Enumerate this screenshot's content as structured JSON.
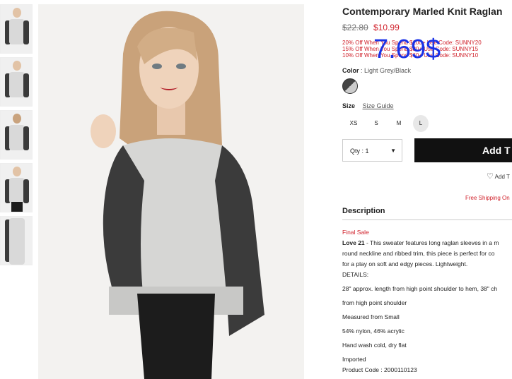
{
  "product": {
    "title": "Contemporary Marled Knit Raglan",
    "old_price": "$22.80",
    "new_price": "$10.99",
    "promos": [
      "20% Off When You Spend $100+ Use Code: SUNNY20",
      "15% Off When You Spend $80+ Use Code: SUNNY15",
      "10% Off When You Spend $60+ Use Code: SUNNY10"
    ],
    "overlay_price": "7.69$",
    "color_label": "Color",
    "color_value": ": Light Grey/Black",
    "size_label": "Size",
    "size_guide": "Size Guide",
    "sizes": [
      "XS",
      "S",
      "M",
      "L"
    ],
    "qty_label": "Qty : 1",
    "add_label": "Add T",
    "wishlist": "Add T",
    "shipping": "Free Shipping On",
    "description_heading": "Description",
    "final_sale": "Final Sale",
    "desc_brand": "Love 21",
    "desc_line1": " - This sweater features long raglan sleeves in a m",
    "desc_line2": "round neckline and ribbed trim, this piece is perfect for co",
    "desc_line3": "for a play on soft and edgy pieces. Lightweight.",
    "desc_details": "DETAILS:",
    "desc_detail1": "28\" approx. length from high point shoulder to hem, 38\" ch",
    "desc_detail2": "from high point shoulder",
    "desc_detail3": "Measured from Small",
    "desc_detail4": "54% nylon, 46% acrylic",
    "desc_detail5": "Hand wash cold, dry flat",
    "desc_detail6": "Imported",
    "desc_detail7": "Product Code : 2000110123"
  },
  "colors": {
    "sale_red": "#d0202a",
    "overlay_blue": "#1a32e6",
    "button": "#111111"
  }
}
